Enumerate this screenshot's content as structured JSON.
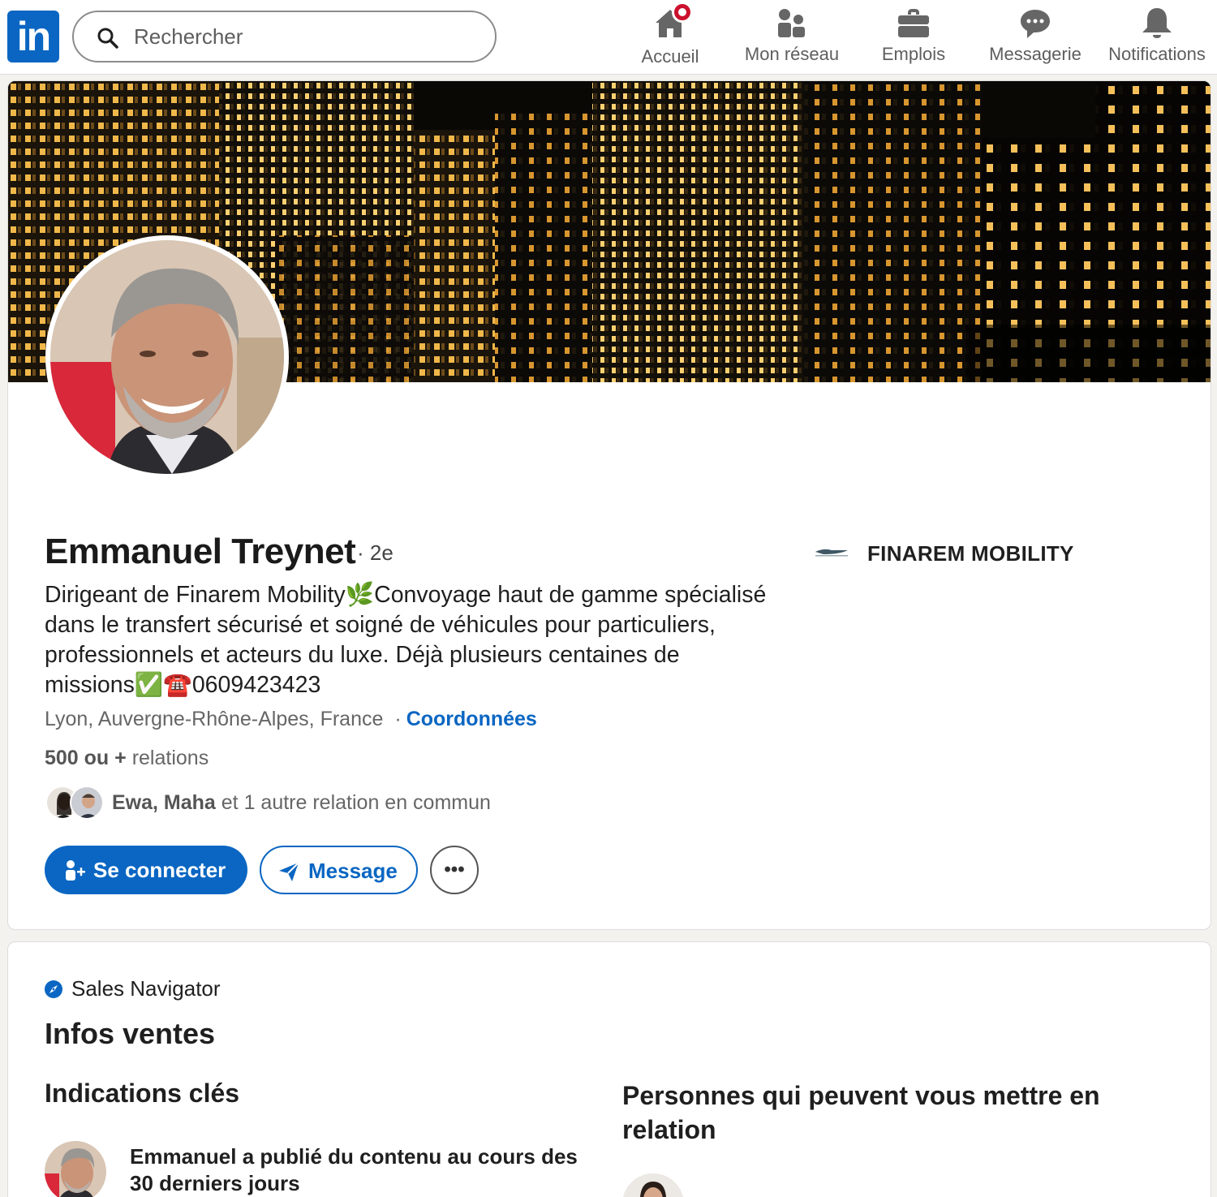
{
  "nav": {
    "logo": "in",
    "search_placeholder": "Rechercher",
    "items": [
      {
        "label": "Accueil",
        "icon": "home-icon"
      },
      {
        "label": "Mon réseau",
        "icon": "network-icon"
      },
      {
        "label": "Emplois",
        "icon": "briefcase-icon"
      },
      {
        "label": "Messagerie",
        "icon": "messaging-icon"
      },
      {
        "label": "Notifications",
        "icon": "bell-icon"
      }
    ]
  },
  "profile": {
    "name": "Emmanuel Treynet",
    "degree": "· 2e",
    "headline": "Dirigeant de Finarem Mobility🌿Convoyage haut de gamme spécialisé dans le transfert sécurisé et soigné de véhicules pour particuliers, professionnels et acteurs du luxe. Déjà plusieurs centaines de missions✅☎️0609423423",
    "location": "Lyon, Auvergne-Rhône-Alpes, France",
    "location_sep": "·",
    "contact_link": "Coordonnées",
    "relations_count": "500 ou +",
    "relations_label": "relations",
    "mutual_names": "Ewa, Maha",
    "mutual_rest": "et 1 autre relation en commun",
    "company_name": "FINAREM MOBILITY",
    "buttons": {
      "connect": "Se connecter",
      "message": "Message",
      "more": "•••"
    }
  },
  "sales": {
    "navigator_label": "Sales Navigator",
    "title": "Infos ventes",
    "insights_title": "Indications clés",
    "insight_text": "Emmanuel a publié du contenu au cours des 30 derniers jours",
    "intro_title": "Personnes qui peuvent vous mettre en relation"
  },
  "colors": {
    "brand": "#0a66c2",
    "notification_badge": "#cb112d",
    "page_bg": "#f4f2ee"
  }
}
